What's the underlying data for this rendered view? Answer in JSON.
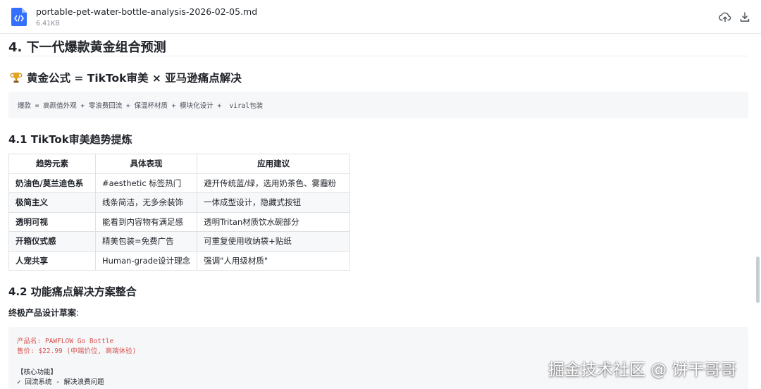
{
  "file": {
    "name": "portable-pet-water-bottle-analysis-2026-02-05.md",
    "size": "6.41KB"
  },
  "icons": {
    "file": "code-file-icon",
    "upload": "cloud-upload-icon",
    "download": "download-icon",
    "trophy": "trophy-icon"
  },
  "colors": {
    "accent": "#3370ff",
    "code_red": "#d9534f"
  },
  "doc": {
    "h2": "4. 下一代爆款黄金组合预测",
    "formula_title": "黄金公式 = TikTok审美 × 亚马逊痛点解决",
    "formula_code": "爆款 = 高颜值外观 + 零浪费回流 + 保温杯材质 + 模块化设计 +  viral包装",
    "section_41": "4.1 TikTok审美趋势提炼",
    "table": {
      "headers": [
        "趋势元素",
        "具体表现",
        "应用建议"
      ],
      "rows": [
        [
          "奶油色/莫兰迪色系",
          "#aesthetic 标签热门",
          "避开传统蓝/绿，选用奶茶色、雾霾粉"
        ],
        [
          "极简主义",
          "线条简洁，无多余装饰",
          "一体成型设计，隐藏式按钮"
        ],
        [
          "透明可视",
          "能看到内容物有满足感",
          "透明Tritan材质饮水碗部分"
        ],
        [
          "开箱仪式感",
          "精美包装=免费广告",
          "可重复使用收纳袋+贴纸"
        ],
        [
          "人宠共享",
          "Human-grade设计理念",
          "强调\"人用级材质\""
        ]
      ]
    },
    "section_42": "4.2 功能痛点解决方案整合",
    "para_bold": "终极产品设计草案",
    "para_colon": ":",
    "code": {
      "line1": "产品名: PAWFLOW Go Bottle",
      "line2": "售价: $22.99 (中端价位, 高端体验)",
      "line3": "【核心功能】",
      "line4": "✓ 回流系统 - 解决浪费问题"
    }
  },
  "watermark": "掘金技术社区 @ 饼干哥哥"
}
